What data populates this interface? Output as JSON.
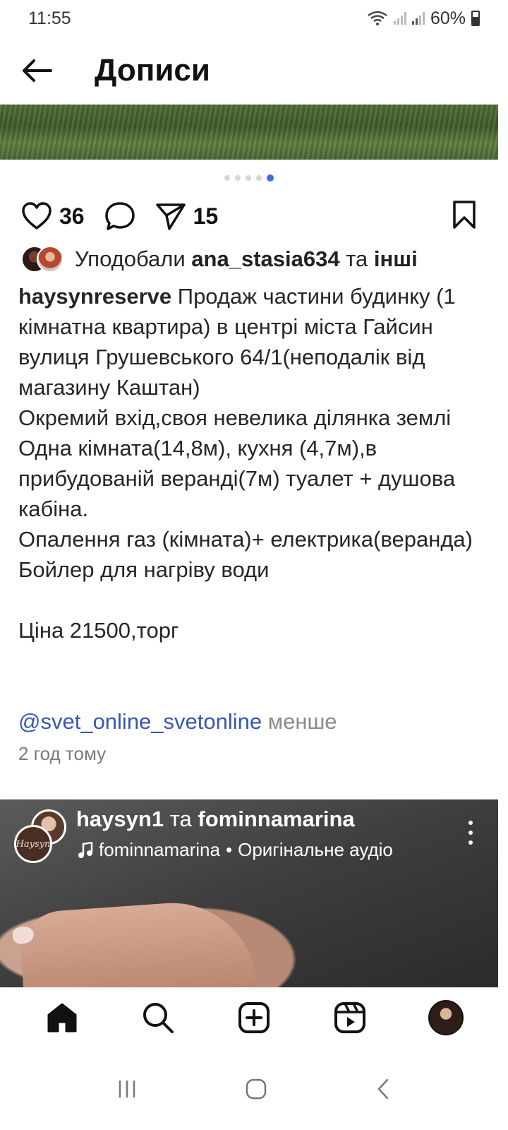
{
  "status_bar": {
    "time": "11:55",
    "battery": "60%"
  },
  "header": {
    "title": "Дописи"
  },
  "carousel": {
    "total": 5,
    "active_index": 4
  },
  "actions": {
    "likes_count": "36",
    "shares_count": "15"
  },
  "likes": {
    "prefix": "Уподобали",
    "user": "ana_stasia634",
    "conj": "та",
    "others": "інші"
  },
  "caption": {
    "username": "haysynreserve",
    "text": " Продаж частини будинку (1 кімнатна квартира) в центрі міста Гайсин вулиця Грушевського 64/1(неподалік від магазину Каштан)\nОкремий вхід,своя невелика ділянка землі\nОдна кімната(14,8м), кухня (4,7м),в прибудованій веранді(7м) туалет + душова кабіна.\nОпалення газ (кімната)+ електрика(веранда)\nБойлер для нагріву води\n\nЦіна 21500,торг",
    "mention": "@svet_online_svetonline",
    "less": "менше",
    "time_ago": "2 год тому"
  },
  "reel": {
    "user1": "haysyn1",
    "conj": "та",
    "user2": "fominnamarina",
    "audio_user": "fominnamarina",
    "separator": "•",
    "audio_label": "Оригінальне аудіо",
    "avatar_text": "Haysyn"
  }
}
